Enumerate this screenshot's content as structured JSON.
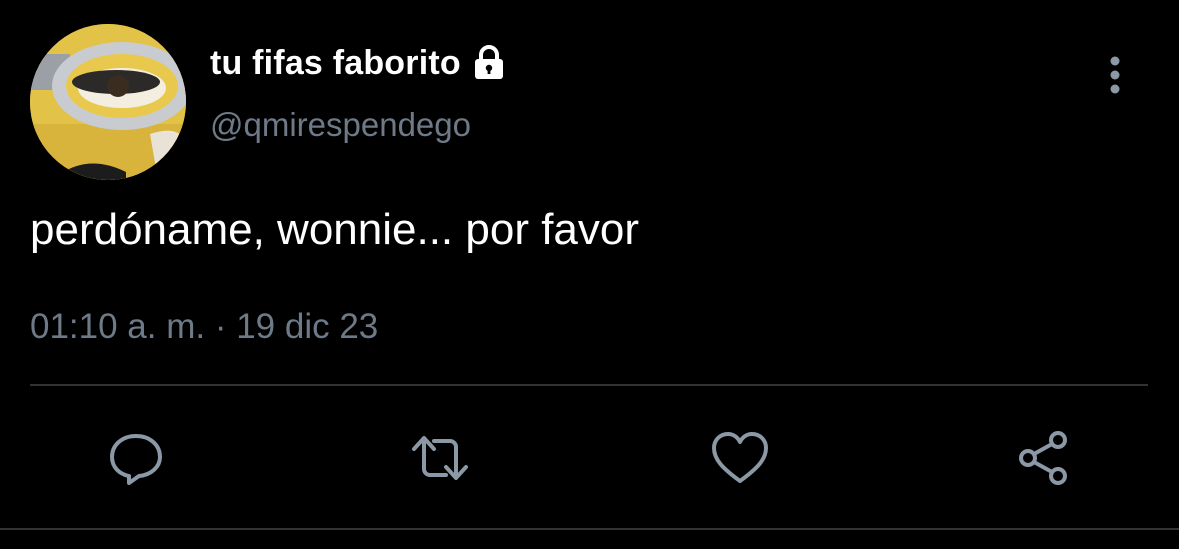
{
  "tweet": {
    "display_name": "tu fifas faborito",
    "handle": "@qmirespendego",
    "text": "perdóname, wonnie... por favor",
    "timestamp": "01:10 a. m. · 19 dic 23",
    "protected_icon": "lock-icon",
    "avatar_description_icon": "avatar"
  },
  "actions": {
    "reply_icon": "reply-icon",
    "retweet_icon": "retweet-icon",
    "like_icon": "like-icon",
    "share_icon": "share-icon",
    "more_icon": "more-vertical-icon"
  },
  "colors": {
    "background": "#000000",
    "primary_text": "#ffffff",
    "secondary_text": "#6e7a87",
    "icon": "#8b98a5",
    "divider": "#2f3336"
  }
}
